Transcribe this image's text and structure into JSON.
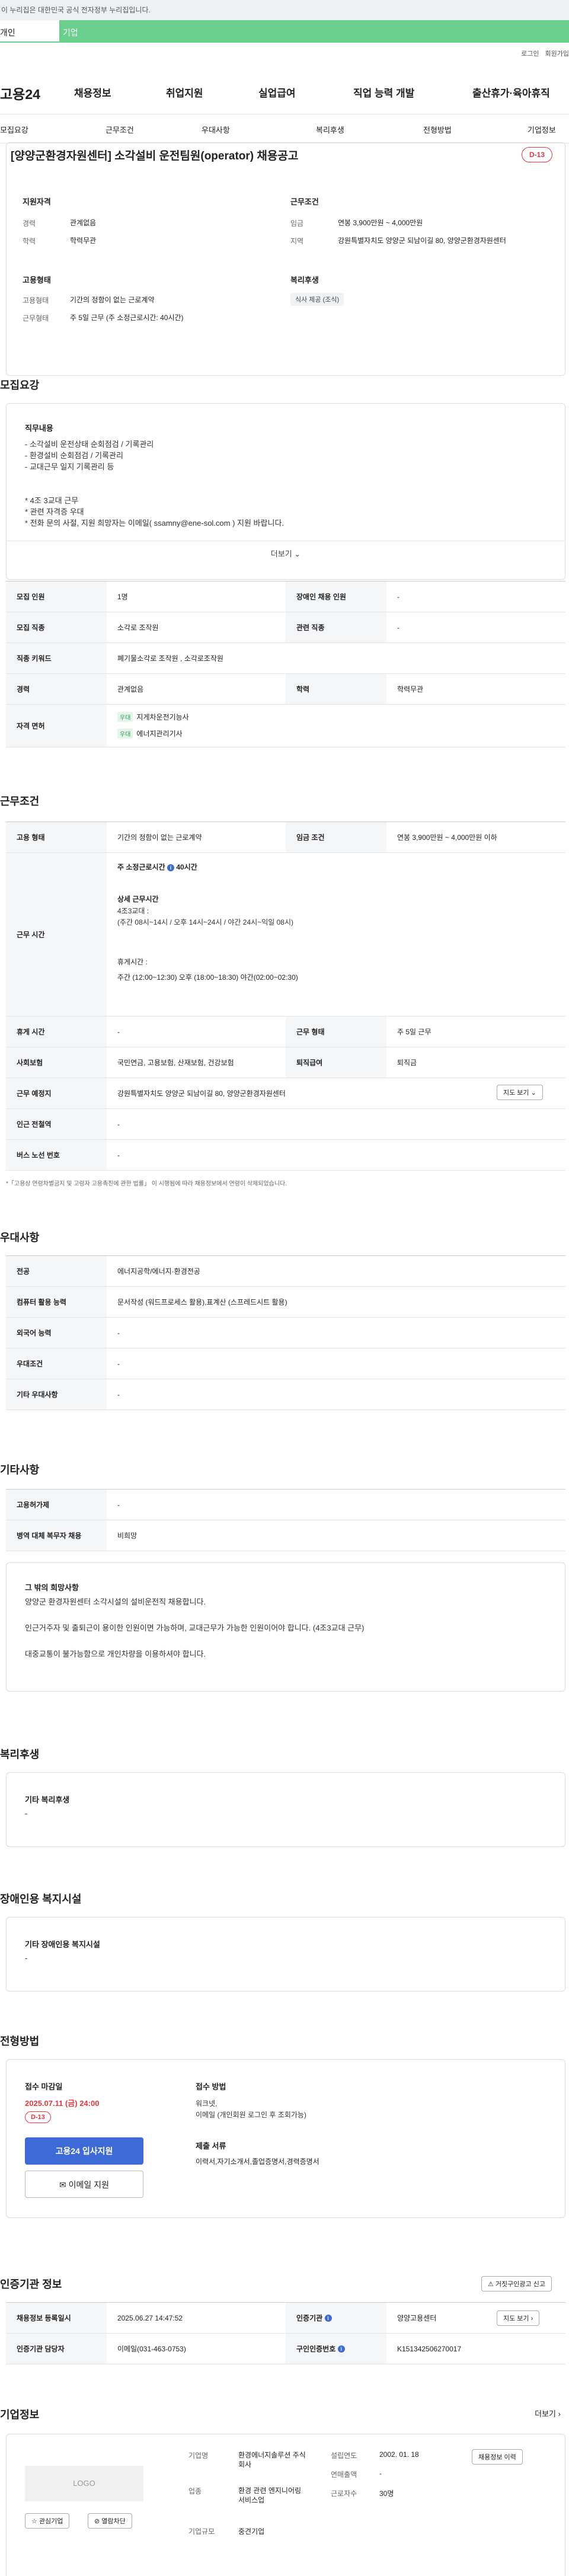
{
  "top": {
    "notice": "이 누리집은 대한민국 공식 전자정부 누리집입니다.",
    "tab_personal": "개인",
    "tab_company": "기업",
    "login": "로그인",
    "signup": "회원가입"
  },
  "brand": {
    "name": "고용24"
  },
  "gnb": [
    "채용정보",
    "취업지원",
    "실업급여",
    "직업 능력 개발",
    "출산휴가·육아휴직"
  ],
  "subnav": [
    "모집요강",
    "근무조건",
    "우대사항",
    "복리후생",
    "전형방법",
    "기업정보"
  ],
  "job": {
    "title": "[양양군환경자원센터] 소각설비 운전팀원(operator) 채용공고",
    "dday": "D-13",
    "qual_title": "지원자격",
    "career_label": "경력",
    "career": "관계없음",
    "edu_label": "학력",
    "edu": "학력무관",
    "emp_title": "고용형태",
    "emp_label": "고용형태",
    "emp": "기간의 정함이 없는 근로계약",
    "work_label": "근무형태",
    "work": "주 5일 근무 (주 소정근로시간: 40시간)",
    "cond_title": "근무조건",
    "wage_label": "임금",
    "wage": "연봉 3,900만원 ~ 4,000만원",
    "loc_label": "지역",
    "loc": "강원특별자치도 양양군 되남이길 80, 양양군환경자원센터",
    "welfare_title": "복리후생",
    "welfare_chip": "식사 제공 (조식)"
  },
  "recruit": {
    "title": "모집요강",
    "duty_title": "직무내용",
    "duty": "- 소각설비 운전상태 순회점검 / 기록관리\n- 환경설비 순회점검 / 기록관리\n- 교대근무 일지 기록관리 등\n\n\n* 4조 3교대 근무\n* 관련 자격증 우대\n* 전화 문의 사절, 지원 희망자는 이메일( ssamny@ene-sol.com ) 지원 바랍니다.",
    "more": "더보기",
    "r1": [
      "모집 인원",
      "1명",
      "장애인 채용 인원",
      "-"
    ],
    "r2": [
      "모집 직종",
      "소각로 조작원",
      "관련 직종",
      "-"
    ],
    "r3": [
      "직종 키워드",
      "폐기물소각로 조작원 , 소각로조작원"
    ],
    "r4": [
      "경력",
      "관계없음",
      "학력",
      "학력무관"
    ],
    "license_label": "자격 면허",
    "lic_tag": "우대",
    "lic1": "지게차운전기능사",
    "lic2": "에너지관리기사"
  },
  "work": {
    "title": "근무조건",
    "r1": [
      "고용 형태",
      "기간의 정함이 없는 근로계약",
      "임금 조건",
      "연봉 3,900만원 ~ 4,000만원 이하"
    ],
    "time_label": "근무 시간",
    "hours": "주 소정근로시간",
    "hours_v": "40시간",
    "detail_title": "상세 근무시간",
    "detail": "4조3교대 :\n(주간 08시~14시 / 오후 14시~24시 / 야간 24시~익일 08시)",
    "rest_title": "휴게시간 :",
    "rest": "주간 (12:00~12:30) 오후 (18:00~18:30) 야간(02:00~02:30)",
    "r2": [
      "휴게 시간",
      "-",
      "근무 형태",
      "주 5일 근무"
    ],
    "r3": [
      "사회보험",
      "국민연금, 고용보험, 산재보험, 건강보험",
      "퇴직급여",
      "퇴직금"
    ],
    "r4": [
      "근무 예정지",
      "강원특별자치도 양양군 되남이길 80, 양양군환경자원센터"
    ],
    "map_btn": "지도 보기",
    "r5": [
      "인근 전철역",
      "-"
    ],
    "r6": [
      "버스 노선 번호",
      "-"
    ],
    "note": "*「고용상 연령차별금지 및 고령자 고용촉진에 관한 법률」 이 시행됨에 따라 채용정보에서 연령이 삭제되었습니다."
  },
  "pref": {
    "title": "우대사항",
    "rows": [
      [
        "전공",
        "에너지공학/에너지·환경전공"
      ],
      [
        "컴퓨터 활용 능력",
        "문서작성 (워드프로세스 활용),표계산 (스프레드시트 활용)"
      ],
      [
        "외국어 능력",
        "-"
      ],
      [
        "우대조건",
        "-"
      ],
      [
        "기타 우대사항",
        "-"
      ]
    ]
  },
  "etc": {
    "title": "기타사항",
    "rows": [
      [
        "고용허가제",
        "-"
      ],
      [
        "병역 대체 복무자 채용",
        "비희망"
      ]
    ],
    "other_title": "그 밖의 희망사항",
    "other": "양양군 환경자원센터 소각시설의 설비운전직 채용합니다.\n\n인근거주자 및 출퇴근이 용이한 인원이면 가능하며, 교대근무가 가능한 인원이어야 합니다. (4조3교대 근무)\n\n대중교통이 불가능함으로 개인차량을 이용하셔야 합니다."
  },
  "welfare": {
    "title": "복리후생",
    "label": "기타 복리후생",
    "value": "-"
  },
  "disabled": {
    "title": "장애인용 복지시설",
    "label": "기타 장애인용 복지시설",
    "value": "-"
  },
  "process": {
    "title": "전형방법",
    "deadline_label": "접수 마감일",
    "deadline": "2025.07.11 (금) 24:00",
    "dday": "D-13",
    "apply_btn": "고용24 입사지원",
    "email_btn": "이메일 지원",
    "method_label": "접수 방법",
    "method": "워크넷,\n이메일 (개인회원 로그인 후 조회가능)",
    "docs_label": "제출 서류",
    "docs": "이력서,자기소개서,졸업증명서,경력증명서"
  },
  "agency": {
    "title": "인증기관 정보",
    "report_btn": "거짓구인광고 신고",
    "r1": [
      "채용정보 등록일시",
      "2025.06.27 14:47:52",
      "인증기관",
      "양양고용센터"
    ],
    "map_btn": "지도 보기",
    "r2": [
      "인증기관 담당자",
      "이메일(031-463-0753)",
      "구인인증번호",
      "K151342506270017"
    ]
  },
  "company": {
    "title": "기업정보",
    "more": "더보기",
    "logo": "LOGO",
    "fav_btn": "관심기업",
    "block_btn": "열람차단",
    "name_label": "기업명",
    "name": "환경에너지솔루션 주식회사",
    "biz_label": "업종",
    "biz": "환경 관련 엔지니어링 서비스업",
    "size_label": "기업규모",
    "size": "중견기업",
    "year_label": "설립연도",
    "year": "2002. 01. 18",
    "sales_label": "연매출액",
    "sales": "-",
    "emp_label": "근로자수",
    "emp": "30명",
    "list_btn": "채용정보 이력"
  }
}
